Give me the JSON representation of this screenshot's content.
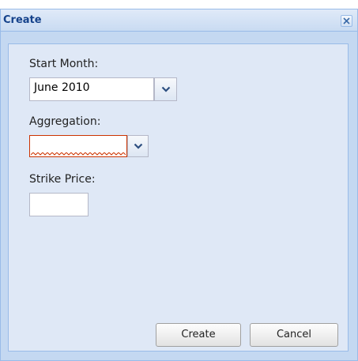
{
  "window": {
    "title": "Create",
    "close_icon": "close-icon"
  },
  "form": {
    "start_month": {
      "label": "Start Month:",
      "value": "June 2010"
    },
    "aggregation": {
      "label": "Aggregation:",
      "value": ""
    },
    "strike_price": {
      "label": "Strike Price:",
      "value": ""
    }
  },
  "buttons": {
    "create": "Create",
    "cancel": "Cancel"
  },
  "colors": {
    "title_text": "#15428b",
    "panel_bg": "#dfe8f6",
    "frame_bg": "#c4d8f1",
    "invalid_border": "#cc3300"
  }
}
